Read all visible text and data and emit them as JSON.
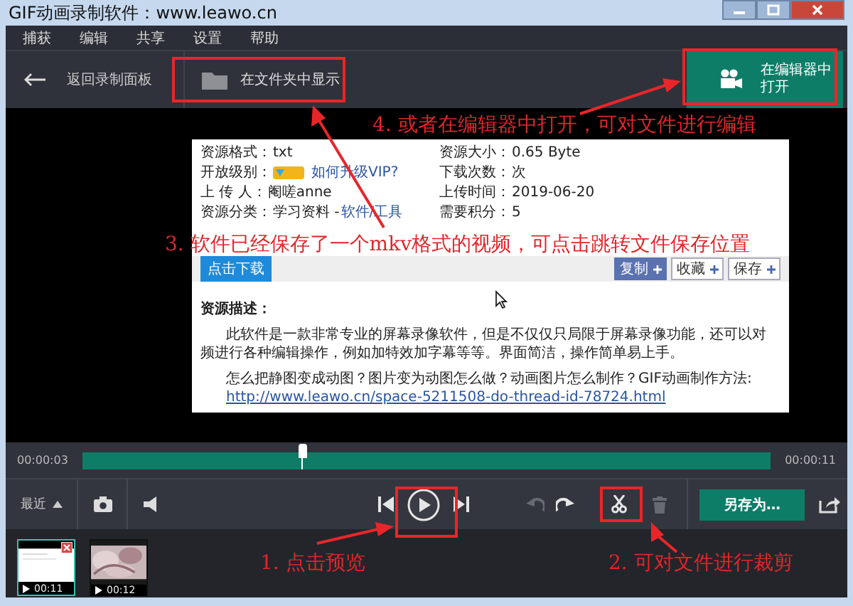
{
  "window": {
    "title": "GIF动画录制软件：www.leawo.cn"
  },
  "menu": [
    "捕获",
    "编辑",
    "共享",
    "设置",
    "帮助"
  ],
  "toolbar": {
    "back": "返回录制面板",
    "show_in_folder": "在文件夹中显示",
    "open_in_editor": "在编辑器中打开"
  },
  "preview_page": {
    "fields": [
      {
        "kind": "text",
        "label": "资源格式：",
        "value": "txt"
      },
      {
        "kind": "text",
        "label": "资源大小：",
        "value": "0.65 Byte"
      },
      {
        "kind": "vip",
        "label": "开放级别：",
        "link": "如何升级VIP?"
      },
      {
        "kind": "text",
        "label": "下载次数：",
        "value": "次"
      },
      {
        "kind": "text",
        "label": "上 传 人：",
        "value": "阉嗟anne"
      },
      {
        "kind": "text",
        "label": "上传时间：",
        "value": "2019-06-20"
      },
      {
        "kind": "link",
        "label": "资源分类：",
        "value": "学习资料 - ",
        "link": "软件/工具"
      },
      {
        "kind": "text",
        "label": "需要积分：",
        "value": "5"
      }
    ],
    "download": "点击下载",
    "actions": [
      "复制",
      "收藏",
      "保存"
    ],
    "description_title": "资源描述：",
    "description_lines": [
      "此软件是一款非常专业的屏幕录像软件，但是不仅仅只局限于屏幕录像功能，还可以对",
      "频进行各种编辑操作，例如加特效加字幕等等。界面简洁，操作简单易上手。"
    ],
    "question": "怎么把静图变成动图？图片变为动图怎么做？动画图片怎么制作？GIF动画制作方法:",
    "link": "http://www.leawo.cn/space-5211508-do-thread-id-78724.html"
  },
  "timeline": {
    "current": "00:00:03",
    "total": "00:00:11",
    "level": 0.32
  },
  "recent": "最近",
  "tools": [
    {
      "kind": "prev",
      "disabled": false
    },
    {
      "kind": "play",
      "disabled": false
    },
    {
      "kind": "next",
      "disabled": false
    },
    {
      "kind": "undo",
      "disabled": true
    },
    {
      "kind": "redo",
      "disabled": false
    },
    {
      "kind": "cut",
      "disabled": false
    },
    {
      "kind": "delete",
      "disabled": true
    }
  ],
  "save_as": "另存为…",
  "clips": [
    {
      "kind": "page",
      "duration": "00:11",
      "selected": true
    },
    {
      "duration": "00:12",
      "selected": false
    }
  ],
  "annotations": [
    "4. 或者在编辑器中打开，可对文件进行编辑",
    "3. 软件已经保存了一个mkv格式的视频，可点击跳转文件保存位置",
    "1. 点击预览",
    "2. 可对文件进行裁剪"
  ]
}
